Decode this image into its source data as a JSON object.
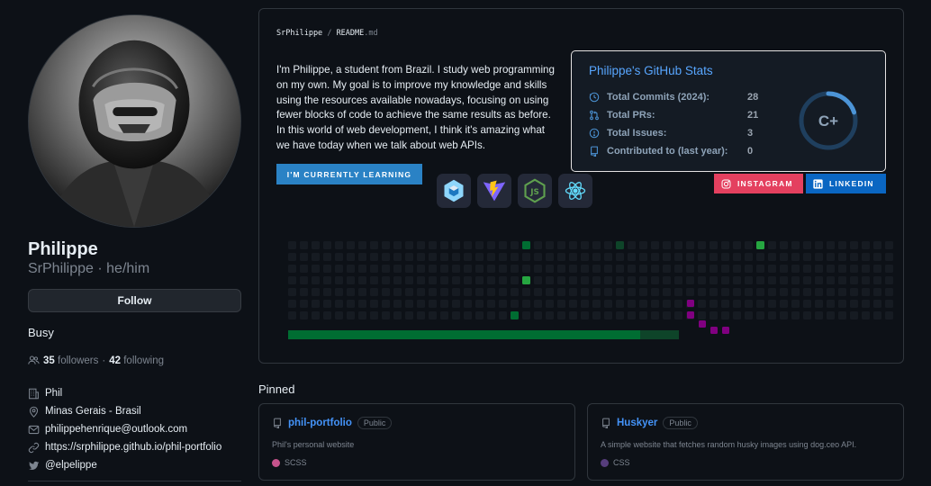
{
  "profile": {
    "name": "Philippe",
    "login_line": "SrPhilippe · he/him",
    "follow_label": "Follow",
    "status": "Busy",
    "followers_count": "35",
    "followers_label": "followers",
    "separator": "·",
    "following_count": "42",
    "following_label": "following",
    "details": {
      "company": "Phil",
      "location": "Minas Gerais - Brasil",
      "email": "philippehenrique@outlook.com",
      "website": "https://srphilippe.github.io/phil-portfolio",
      "twitter": "@elpelippe"
    }
  },
  "readme": {
    "path_user": "SrPhilippe",
    "path_sep": "/",
    "path_file": "README",
    "path_ext": ".md",
    "intro": "I'm Philippe, a student from Brazil. I study web programming on my own. My goal is to improve my knowledge and skills using the resources available nowadays, focusing on using fewer blocks of code to achieve the same results as before. In this world of web development, I think it's amazing what we have today when we talk about web APIs.",
    "learning_badge": "I'M CURRENTLY LEARNING",
    "tech_icons": [
      "webpack-icon",
      "vite-icon",
      "nodejs-icon",
      "react-icon"
    ],
    "stats": {
      "title": "Philippe's GitHub Stats",
      "rows": [
        {
          "label": "Total Commits (2024):",
          "value": "28",
          "icon": "clock-icon"
        },
        {
          "label": "Total PRs:",
          "value": "21",
          "icon": "pull-request-icon"
        },
        {
          "label": "Total Issues:",
          "value": "3",
          "icon": "issue-icon"
        },
        {
          "label": "Contributed to (last year):",
          "value": "0",
          "icon": "repo-icon"
        }
      ],
      "rank": "C+",
      "rank_progress": 0.2
    },
    "social": {
      "instagram": "INSTAGRAM",
      "linkedin": "LINKEDIN"
    },
    "snake_progress": 0.9
  },
  "pinned": {
    "title": "Pinned",
    "repos": [
      {
        "name": "phil-portfolio",
        "visibility": "Public",
        "description": "Phil's personal website",
        "language": "SCSS",
        "lang_color": "#c6538c"
      },
      {
        "name": "Huskyer",
        "visibility": "Public",
        "description": "A simple website that fetches random husky images using dog.ceo API.",
        "language": "CSS",
        "lang_color": "#563d7c"
      }
    ]
  },
  "colors": {
    "accent": "#58a6ff",
    "learning_badge": "#2a82c5",
    "instagram": "#e4405f",
    "linkedin": "#0a66c2",
    "contrib_green": "#26a641",
    "snake_purple": "#800080"
  }
}
